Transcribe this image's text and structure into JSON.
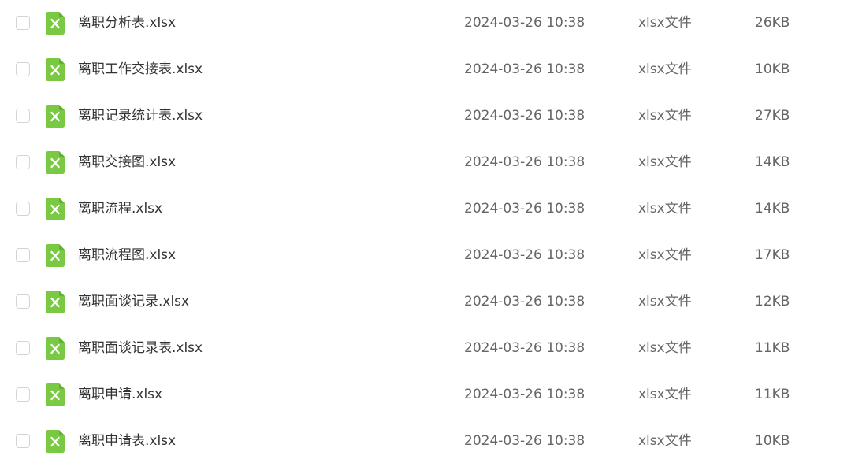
{
  "files": [
    {
      "name": "离职分析表.xlsx",
      "date": "2024-03-26 10:38",
      "type": "xlsx文件",
      "size": "26KB"
    },
    {
      "name": "离职工作交接表.xlsx",
      "date": "2024-03-26 10:38",
      "type": "xlsx文件",
      "size": "10KB"
    },
    {
      "name": "离职记录统计表.xlsx",
      "date": "2024-03-26 10:38",
      "type": "xlsx文件",
      "size": "27KB"
    },
    {
      "name": "离职交接图.xlsx",
      "date": "2024-03-26 10:38",
      "type": "xlsx文件",
      "size": "14KB"
    },
    {
      "name": "离职流程.xlsx",
      "date": "2024-03-26 10:38",
      "type": "xlsx文件",
      "size": "14KB"
    },
    {
      "name": "离职流程图.xlsx",
      "date": "2024-03-26 10:38",
      "type": "xlsx文件",
      "size": "17KB"
    },
    {
      "name": "离职面谈记录.xlsx",
      "date": "2024-03-26 10:38",
      "type": "xlsx文件",
      "size": "12KB"
    },
    {
      "name": "离职面谈记录表.xlsx",
      "date": "2024-03-26 10:38",
      "type": "xlsx文件",
      "size": "11KB"
    },
    {
      "name": "离职申请.xlsx",
      "date": "2024-03-26 10:38",
      "type": "xlsx文件",
      "size": "11KB"
    },
    {
      "name": "离职申请表.xlsx",
      "date": "2024-03-26 10:38",
      "type": "xlsx文件",
      "size": "10KB"
    }
  ],
  "icon": "excel-file-icon",
  "colors": {
    "icon_green": "#7ac943",
    "icon_green_dark": "#5fb034",
    "name_text": "#333333",
    "meta_text": "#666666",
    "checkbox_border": "#d4d4d4"
  }
}
